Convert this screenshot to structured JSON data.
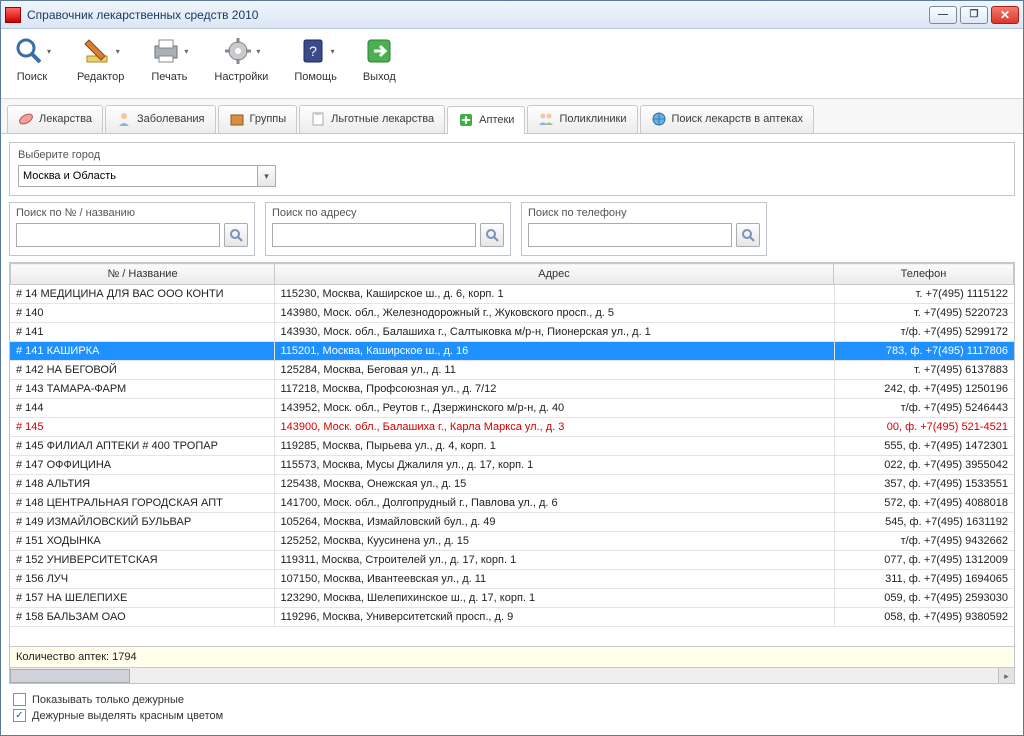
{
  "window": {
    "title": "Справочник лекарственных средств 2010"
  },
  "toolbar": [
    {
      "label": "Поиск",
      "dropdown": true,
      "icon": "search"
    },
    {
      "label": "Редактор",
      "dropdown": true,
      "icon": "edit"
    },
    {
      "label": "Печать",
      "dropdown": true,
      "icon": "print"
    },
    {
      "label": "Настройки",
      "dropdown": true,
      "icon": "gear"
    },
    {
      "label": "Помощь",
      "dropdown": true,
      "icon": "help"
    },
    {
      "label": "Выход",
      "dropdown": false,
      "icon": "exit"
    }
  ],
  "tabs": [
    {
      "label": "Лекарства",
      "icon": "pill"
    },
    {
      "label": "Заболевания",
      "icon": "person"
    },
    {
      "label": "Группы",
      "icon": "box"
    },
    {
      "label": "Льготные лекарства",
      "icon": "clipboard"
    },
    {
      "label": "Аптеки",
      "icon": "plus",
      "active": true
    },
    {
      "label": "Поликлиники",
      "icon": "people"
    },
    {
      "label": "Поиск лекарств в аптеках",
      "icon": "globe"
    }
  ],
  "city_panel": {
    "label": "Выберите город",
    "value": "Москва и Область"
  },
  "searches": [
    {
      "label": "Поиск по № / названию",
      "value": ""
    },
    {
      "label": "Поиск по адресу",
      "value": ""
    },
    {
      "label": "Поиск по телефону",
      "value": ""
    }
  ],
  "table": {
    "columns": [
      "№ / Название",
      "Адрес",
      "Телефон"
    ],
    "rows": [
      {
        "name": "# 14 МЕДИЦИНА ДЛЯ ВАС ООО КОНТИ",
        "addr": "115230, Москва, Каширское ш., д. 6, корп. 1",
        "tel": "т. +7(495) 1115122"
      },
      {
        "name": "# 140",
        "addr": "143980, Моск. обл., Железнодорожный г., Жуковского просп., д. 5",
        "tel": "т. +7(495) 5220723"
      },
      {
        "name": "# 141",
        "addr": "143930, Моск. обл., Балашиха г., Салтыковка м/р-н, Пионерская ул., д. 1",
        "tel": "т/ф. +7(495) 5299172"
      },
      {
        "name": "# 141 КАШИРКА",
        "addr": "115201, Москва, Каширское ш., д. 16",
        "tel": "783, ф. +7(495) 1117806",
        "selected": true
      },
      {
        "name": "# 142 НА БЕГОВОЙ",
        "addr": "125284, Москва, Беговая ул., д. 11",
        "tel": "т. +7(495) 6137883"
      },
      {
        "name": "# 143 ТАМАРА-ФАРМ",
        "addr": "117218, Москва, Профсоюзная ул., д. 7/12",
        "tel": "242, ф. +7(495) 1250196"
      },
      {
        "name": "# 144",
        "addr": "143952, Моск. обл., Реутов г., Дзержинского м/р-н, д. 40",
        "tel": "т/ф. +7(495) 5246443"
      },
      {
        "name": "# 145",
        "addr": "143900, Моск. обл., Балашиха г., Карла Маркса ул., д. 3",
        "tel": "00, ф. +7(495) 521-4521",
        "red": true
      },
      {
        "name": "# 145 ФИЛИАЛ АПТЕКИ # 400 ТРОПАР",
        "addr": "119285, Москва, Пырьева ул., д. 4, корп. 1",
        "tel": "555, ф. +7(495) 1472301"
      },
      {
        "name": "# 147 ОФФИЦИНА",
        "addr": "115573, Москва, Мусы Джалиля ул., д. 17, корп. 1",
        "tel": "022, ф. +7(495) 3955042"
      },
      {
        "name": "# 148 АЛЬТИЯ",
        "addr": "125438, Москва, Онежская ул., д. 15",
        "tel": "357, ф. +7(495) 1533551"
      },
      {
        "name": "# 148 ЦЕНТРАЛЬНАЯ ГОРОДСКАЯ АПТ",
        "addr": "141700, Моск. обл., Долгопрудный г., Павлова ул., д. 6",
        "tel": "572, ф. +7(495) 4088018"
      },
      {
        "name": "# 149 ИЗМАЙЛОВСКИЙ БУЛЬВАР",
        "addr": "105264, Москва, Измайловский бул., д. 49",
        "tel": "545, ф. +7(495) 1631192"
      },
      {
        "name": "# 151 ХОДЫНКА",
        "addr": "125252, Москва, Куусинена ул., д. 15",
        "tel": "т/ф. +7(495) 9432662"
      },
      {
        "name": "# 152 УНИВЕРСИТЕТСКАЯ",
        "addr": "119311, Москва, Строителей ул., д. 17, корп. 1",
        "tel": "077, ф. +7(495) 1312009"
      },
      {
        "name": "# 156 ЛУЧ",
        "addr": "107150, Москва, Ивантеевская ул., д. 11",
        "tel": "311, ф. +7(495) 1694065"
      },
      {
        "name": "# 157 НА ШЕЛЕПИХЕ",
        "addr": "123290, Москва, Шелепихинское ш., д. 17, корп. 1",
        "tel": "059, ф. +7(495) 2593030"
      },
      {
        "name": "# 158 БАЛЬЗАМ ОАО",
        "addr": "119296, Москва, Университетский просп., д. 9",
        "tel": "058, ф. +7(495) 9380592"
      }
    ],
    "footer": "Количество аптек: 1794"
  },
  "checkbox1": {
    "label": "Показывать только дежурные",
    "checked": false
  },
  "checkbox2": {
    "label": "Дежурные выделять красным цветом",
    "checked": true
  }
}
